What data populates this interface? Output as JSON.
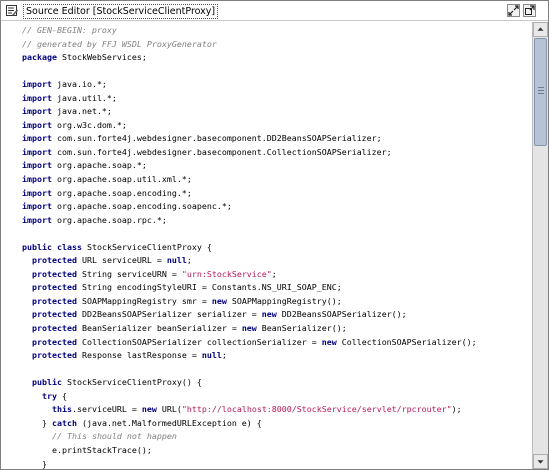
{
  "window": {
    "title": "Source Editor [StockServiceClientProxy]"
  },
  "icons": {
    "title_icon": "editor-document-icon",
    "restore": "restore-window-icon",
    "maximize": "maximize-window-icon",
    "scroll_up": "scroll-up-arrow-icon",
    "scroll_down": "scroll-down-arrow-icon"
  },
  "colors": {
    "keyword": "#00007f",
    "comment": "#808080",
    "string": "#b5195b",
    "scroll_thumb": "#b7c2d6"
  },
  "editor": {
    "lines": [
      [
        {
          "t": "// GEN-BEGIN: proxy",
          "k": "comment"
        }
      ],
      [
        {
          "t": "// generated by FFJ WSDL ProxyGenerator",
          "k": "comment"
        }
      ],
      [
        {
          "t": "package",
          "k": "kw"
        },
        {
          "t": " StockWebServices;",
          "k": "plain"
        }
      ],
      [],
      [
        {
          "t": "import",
          "k": "kw"
        },
        {
          "t": " java.io.*;",
          "k": "plain"
        }
      ],
      [
        {
          "t": "import",
          "k": "kw"
        },
        {
          "t": " java.util.*;",
          "k": "plain"
        }
      ],
      [
        {
          "t": "import",
          "k": "kw"
        },
        {
          "t": " java.net.*;",
          "k": "plain"
        }
      ],
      [
        {
          "t": "import",
          "k": "kw"
        },
        {
          "t": " org.w3c.dom.*;",
          "k": "plain"
        }
      ],
      [
        {
          "t": "import",
          "k": "kw"
        },
        {
          "t": " com.sun.forte4j.webdesigner.basecomponent.DD2BeansSOAPSerializer;",
          "k": "plain"
        }
      ],
      [
        {
          "t": "import",
          "k": "kw"
        },
        {
          "t": " com.sun.forte4j.webdesigner.basecomponent.CollectionSOAPSerializer;",
          "k": "plain"
        }
      ],
      [
        {
          "t": "import",
          "k": "kw"
        },
        {
          "t": " org.apache.soap.*;",
          "k": "plain"
        }
      ],
      [
        {
          "t": "import",
          "k": "kw"
        },
        {
          "t": " org.apache.soap.util.xml.*;",
          "k": "plain"
        }
      ],
      [
        {
          "t": "import",
          "k": "kw"
        },
        {
          "t": " org.apache.soap.encoding.*;",
          "k": "plain"
        }
      ],
      [
        {
          "t": "import",
          "k": "kw"
        },
        {
          "t": " org.apache.soap.encoding.soapenc.*;",
          "k": "plain"
        }
      ],
      [
        {
          "t": "import",
          "k": "kw"
        },
        {
          "t": " org.apache.soap.rpc.*;",
          "k": "plain"
        }
      ],
      [],
      [
        {
          "t": "public",
          "k": "kw"
        },
        {
          "t": " ",
          "k": "plain"
        },
        {
          "t": "class",
          "k": "kw"
        },
        {
          "t": " StockServiceClientProxy {",
          "k": "plain"
        }
      ],
      [
        {
          "t": "  ",
          "k": "plain"
        },
        {
          "t": "protected",
          "k": "kw"
        },
        {
          "t": " URL serviceURL = ",
          "k": "plain"
        },
        {
          "t": "null",
          "k": "kw"
        },
        {
          "t": ";",
          "k": "plain"
        }
      ],
      [
        {
          "t": "  ",
          "k": "plain"
        },
        {
          "t": "protected",
          "k": "kw"
        },
        {
          "t": " String serviceURN = ",
          "k": "plain"
        },
        {
          "t": "\"urn:StockService\"",
          "k": "str"
        },
        {
          "t": ";",
          "k": "plain"
        }
      ],
      [
        {
          "t": "  ",
          "k": "plain"
        },
        {
          "t": "protected",
          "k": "kw"
        },
        {
          "t": " String encodingStyleURI = Constants.NS_URI_SOAP_ENC;",
          "k": "plain"
        }
      ],
      [
        {
          "t": "  ",
          "k": "plain"
        },
        {
          "t": "protected",
          "k": "kw"
        },
        {
          "t": " SOAPMappingRegistry smr = ",
          "k": "plain"
        },
        {
          "t": "new",
          "k": "kw"
        },
        {
          "t": " SOAPMappingRegistry();",
          "k": "plain"
        }
      ],
      [
        {
          "t": "  ",
          "k": "plain"
        },
        {
          "t": "protected",
          "k": "kw"
        },
        {
          "t": " DD2BeansSOAPSerializer serializer = ",
          "k": "plain"
        },
        {
          "t": "new",
          "k": "kw"
        },
        {
          "t": " DD2BeansSOAPSerializer();",
          "k": "plain"
        }
      ],
      [
        {
          "t": "  ",
          "k": "plain"
        },
        {
          "t": "protected",
          "k": "kw"
        },
        {
          "t": " BeanSerializer beanSerializer = ",
          "k": "plain"
        },
        {
          "t": "new",
          "k": "kw"
        },
        {
          "t": " BeanSerializer();",
          "k": "plain"
        }
      ],
      [
        {
          "t": "  ",
          "k": "plain"
        },
        {
          "t": "protected",
          "k": "kw"
        },
        {
          "t": " CollectionSOAPSerializer collectionSerializer = ",
          "k": "plain"
        },
        {
          "t": "new",
          "k": "kw"
        },
        {
          "t": " CollectionSOAPSerializer();",
          "k": "plain"
        }
      ],
      [
        {
          "t": "  ",
          "k": "plain"
        },
        {
          "t": "protected",
          "k": "kw"
        },
        {
          "t": " Response lastResponse = ",
          "k": "plain"
        },
        {
          "t": "null",
          "k": "kw"
        },
        {
          "t": ";",
          "k": "plain"
        }
      ],
      [],
      [
        {
          "t": "  ",
          "k": "plain"
        },
        {
          "t": "public",
          "k": "kw"
        },
        {
          "t": " StockServiceClientProxy() {",
          "k": "plain"
        }
      ],
      [
        {
          "t": "    ",
          "k": "plain"
        },
        {
          "t": "try",
          "k": "kw"
        },
        {
          "t": " {",
          "k": "plain"
        }
      ],
      [
        {
          "t": "      ",
          "k": "plain"
        },
        {
          "t": "this",
          "k": "kw"
        },
        {
          "t": ".serviceURL = ",
          "k": "plain"
        },
        {
          "t": "new",
          "k": "kw"
        },
        {
          "t": " URL(",
          "k": "plain"
        },
        {
          "t": "\"http://localhost:8000/StockService/servlet/rpcrouter\"",
          "k": "str"
        },
        {
          "t": ");",
          "k": "plain"
        }
      ],
      [
        {
          "t": "    } ",
          "k": "plain"
        },
        {
          "t": "catch",
          "k": "kw"
        },
        {
          "t": " (java.net.MalformedURLException e) {",
          "k": "plain"
        }
      ],
      [
        {
          "t": "      ",
          "k": "plain"
        },
        {
          "t": "// This should not happen",
          "k": "comment"
        }
      ],
      [
        {
          "t": "      e.printStackTrace();",
          "k": "plain"
        }
      ],
      [
        {
          "t": "    }",
          "k": "plain"
        }
      ]
    ]
  }
}
